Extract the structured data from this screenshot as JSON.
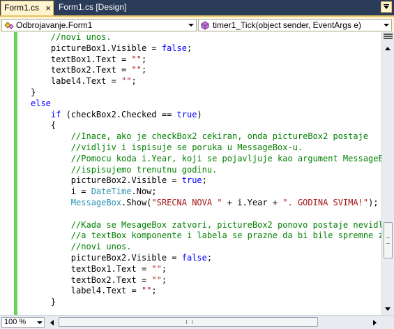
{
  "tabs": [
    {
      "label": "Form1.cs",
      "close_glyph": "×"
    },
    {
      "label": "Form1.cs [Design]"
    }
  ],
  "navbar": {
    "class_combo": {
      "value": "Odbrojavanje.Form1",
      "icon": "class-icon"
    },
    "member_combo": {
      "value": "timer1_Tick(object sender, EventArgs e)",
      "icon": "method-icon"
    }
  },
  "zoom": {
    "value": "100 %"
  },
  "colors": {
    "keyword": "#0000ff",
    "comment": "#008000",
    "string": "#a31515",
    "type": "#2b91af",
    "change_bar": "#6cd35a",
    "tab_active_bg": "#fff4cf",
    "chrome_dark": "#293955"
  },
  "code_lines": [
    [
      {
        "t": "    ",
        "c": ""
      },
      {
        "t": "//novi unos.",
        "c": "cm"
      }
    ],
    [
      {
        "t": "    pictureBox1.Visible = ",
        "c": ""
      },
      {
        "t": "false",
        "c": "kw"
      },
      {
        "t": ";",
        "c": ""
      }
    ],
    [
      {
        "t": "    textBox1.Text = ",
        "c": ""
      },
      {
        "t": "\"\"",
        "c": "st"
      },
      {
        "t": ";",
        "c": ""
      }
    ],
    [
      {
        "t": "    textBox2.Text = ",
        "c": ""
      },
      {
        "t": "\"\"",
        "c": "st"
      },
      {
        "t": ";",
        "c": ""
      }
    ],
    [
      {
        "t": "    label4.Text = ",
        "c": ""
      },
      {
        "t": "\"\"",
        "c": "st"
      },
      {
        "t": ";",
        "c": ""
      }
    ],
    [
      {
        "t": "}",
        "c": ""
      }
    ],
    [
      {
        "t": "else",
        "c": "kw"
      }
    ],
    [
      {
        "t": "    ",
        "c": ""
      },
      {
        "t": "if",
        "c": "kw"
      },
      {
        "t": " (checkBox2.Checked == ",
        "c": ""
      },
      {
        "t": "true",
        "c": "kw"
      },
      {
        "t": ")",
        "c": ""
      }
    ],
    [
      {
        "t": "    {",
        "c": ""
      }
    ],
    [
      {
        "t": "        ",
        "c": ""
      },
      {
        "t": "//Inace, ako je checkBox2 cekiran, onda pictureBox2 postaje",
        "c": "cm"
      }
    ],
    [
      {
        "t": "        ",
        "c": ""
      },
      {
        "t": "//vidljiv i ispisuje se poruka u MessageBox-u.",
        "c": "cm"
      }
    ],
    [
      {
        "t": "        ",
        "c": ""
      },
      {
        "t": "//Pomocu koda i.Year, koji se pojavljuje kao argument MessageBox",
        "c": "cm"
      }
    ],
    [
      {
        "t": "        ",
        "c": ""
      },
      {
        "t": "//ispisujemo trenutnu godinu.",
        "c": "cm"
      }
    ],
    [
      {
        "t": "        pictureBox2.Visible = ",
        "c": ""
      },
      {
        "t": "true",
        "c": "kw"
      },
      {
        "t": ";",
        "c": ""
      }
    ],
    [
      {
        "t": "        i = ",
        "c": ""
      },
      {
        "t": "DateTime",
        "c": "ty"
      },
      {
        "t": ".Now;",
        "c": ""
      }
    ],
    [
      {
        "t": "        ",
        "c": ""
      },
      {
        "t": "MessageBox",
        "c": "ty"
      },
      {
        "t": ".Show(",
        "c": ""
      },
      {
        "t": "\"SRECNA NOVA \"",
        "c": "st"
      },
      {
        "t": " + i.Year + ",
        "c": ""
      },
      {
        "t": "\". GODINA SVIMA!\"",
        "c": "st"
      },
      {
        "t": ");",
        "c": ""
      }
    ],
    [
      {
        "t": "",
        "c": ""
      }
    ],
    [
      {
        "t": "        ",
        "c": ""
      },
      {
        "t": "//Kada se MesageBox zatvori, pictureBox2 ponovo postaje nevidlji",
        "c": "cm"
      }
    ],
    [
      {
        "t": "        ",
        "c": ""
      },
      {
        "t": "//a textBox komponente i labela se prazne da bi bile spremne za",
        "c": "cm"
      }
    ],
    [
      {
        "t": "        ",
        "c": ""
      },
      {
        "t": "//novi unos.",
        "c": "cm"
      }
    ],
    [
      {
        "t": "        pictureBox2.Visible = ",
        "c": ""
      },
      {
        "t": "false",
        "c": "kw"
      },
      {
        "t": ";",
        "c": ""
      }
    ],
    [
      {
        "t": "        textBox1.Text = ",
        "c": ""
      },
      {
        "t": "\"\"",
        "c": "st"
      },
      {
        "t": ";",
        "c": ""
      }
    ],
    [
      {
        "t": "        textBox2.Text = ",
        "c": ""
      },
      {
        "t": "\"\"",
        "c": "st"
      },
      {
        "t": ";",
        "c": ""
      }
    ],
    [
      {
        "t": "        label4.Text = ",
        "c": ""
      },
      {
        "t": "\"\"",
        "c": "st"
      },
      {
        "t": ";",
        "c": ""
      }
    ],
    [
      {
        "t": "    }",
        "c": ""
      }
    ]
  ]
}
